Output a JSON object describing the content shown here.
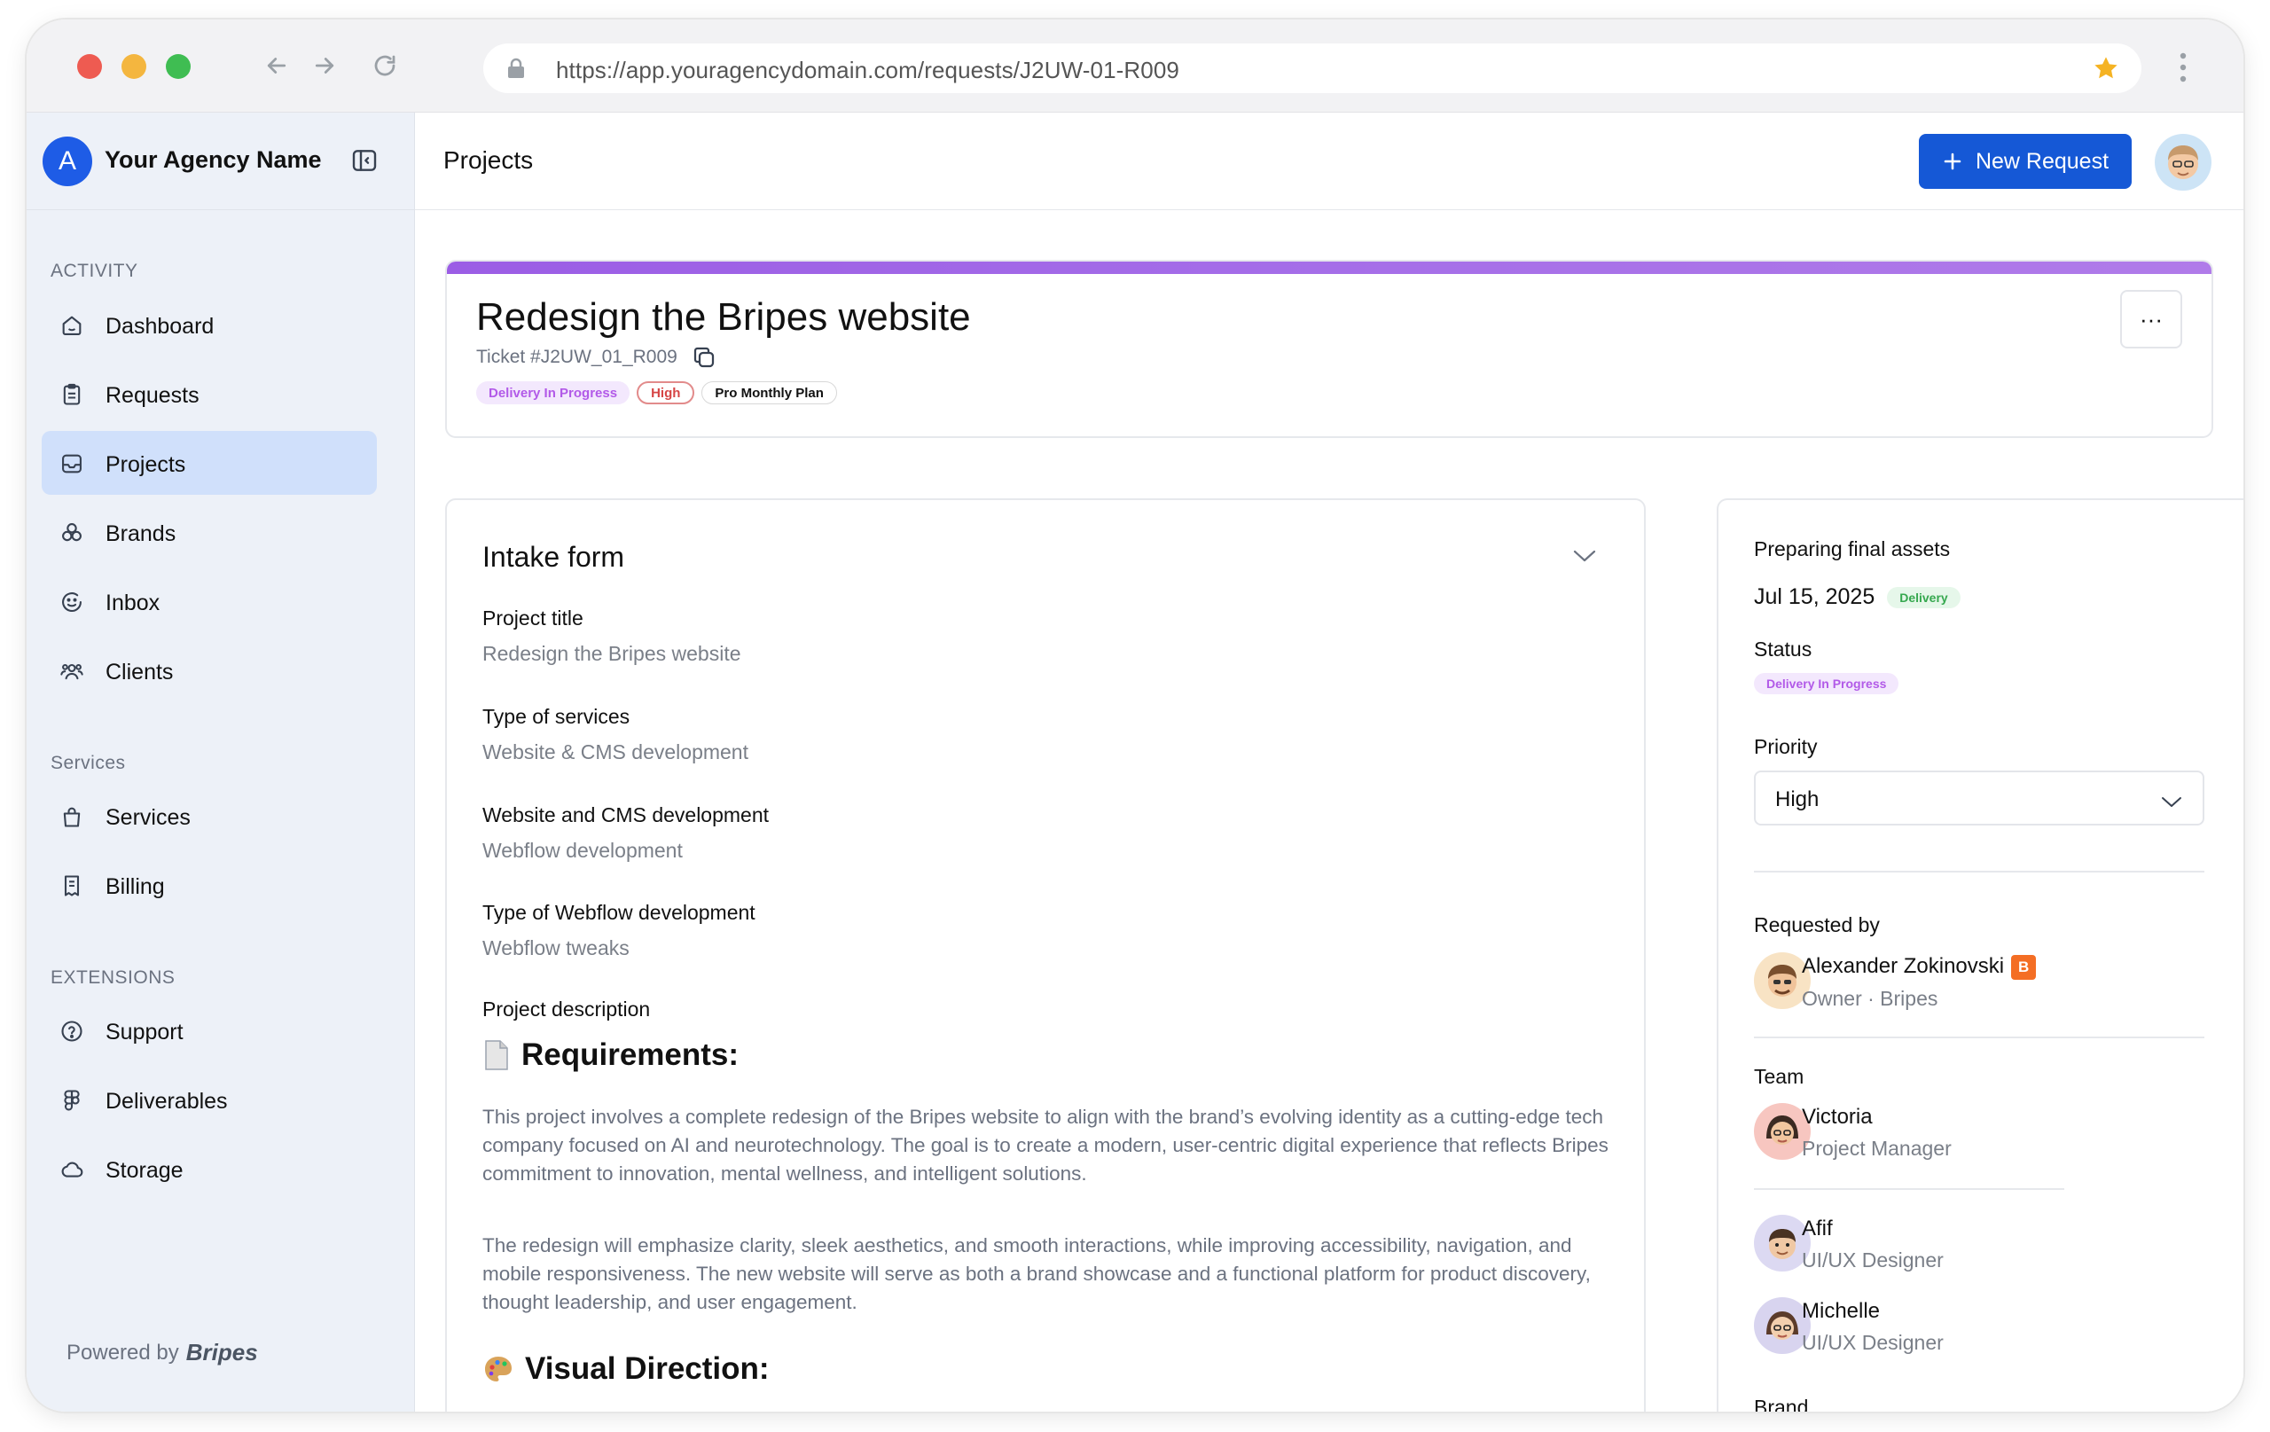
{
  "browser": {
    "url": "https://app.youragencydomain.com/requests/J2UW-01-R009"
  },
  "sidebar": {
    "brand_initial": "A",
    "brand_name": "Your Agency Name",
    "sections": {
      "activity": "ACTIVITY",
      "services": "Services",
      "extensions": "EXTENSIONS"
    },
    "items": {
      "dashboard": "Dashboard",
      "requests": "Requests",
      "projects": "Projects",
      "brands": "Brands",
      "inbox": "Inbox",
      "clients": "Clients",
      "services": "Services",
      "billing": "Billing",
      "support": "Support",
      "deliverables": "Deliverables",
      "storage": "Storage"
    },
    "active_item": "projects",
    "powered_by": "Powered by",
    "powered_brand": "Bripes"
  },
  "header": {
    "page_title": "Projects",
    "new_request_label": "New Request"
  },
  "request": {
    "title": "Redesign the Bripes website",
    "ticket": "Ticket #J2UW_01_R009",
    "tags": {
      "status": "Delivery In Progress",
      "priority": "High",
      "plan": "Pro Monthly Plan"
    },
    "more_label": "···"
  },
  "intake": {
    "title": "Intake form",
    "fields": [
      {
        "label": "Project title",
        "value": "Redesign the Bripes website"
      },
      {
        "label": "Type of services",
        "value": "Website & CMS development"
      },
      {
        "label": "Website and CMS development",
        "value": "Webflow development"
      },
      {
        "label": "Type of Webflow development",
        "value": "Webflow tweaks"
      }
    ],
    "description_label": "Project description",
    "requirements_heading": "Requirements:",
    "paragraph_1": "This project involves a complete redesign of the Bripes website to align with the brand’s evolving identity as a cutting-edge tech company focused on AI and neurotechnology. The goal is to create a modern, user-centric digital experience that reflects Bripes commitment to innovation, mental wellness, and intelligent solutions.",
    "paragraph_2": "The redesign will emphasize clarity, sleek aesthetics, and smooth interactions, while improving accessibility, navigation, and mobile responsiveness. The new website will serve as both a brand showcase and a functional platform for product discovery, thought leadership, and user engagement.",
    "visual_heading": "Visual Direction:"
  },
  "details": {
    "milestone_label": "Preparing final assets",
    "milestone_date": "Jul 15, 2025",
    "milestone_tag": "Delivery",
    "status_label": "Status",
    "status_value": "Delivery In Progress",
    "priority_label": "Priority",
    "priority_value": "High",
    "requested_by_label": "Requested by",
    "requester": {
      "name": "Alexander Zokinovski",
      "badge": "B",
      "role": "Owner · Bripes"
    },
    "team_label": "Team",
    "team": [
      {
        "name": "Victoria",
        "role": "Project Manager"
      },
      {
        "name": "Afif",
        "role": "UI/UX Designer"
      },
      {
        "name": "Michelle",
        "role": "UI/UX Designer"
      }
    ],
    "brand_label": "Brand"
  },
  "colors": {
    "primary": "#1558d6",
    "accent_purple": "#9b5de5",
    "sidebar_bg": "#edf1f8",
    "active_bg": "#d0e0fb"
  }
}
